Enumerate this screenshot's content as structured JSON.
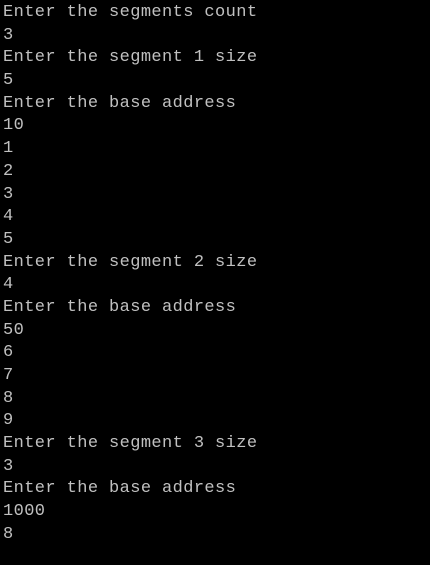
{
  "console": {
    "text_color": "#c0c0c0",
    "background_color": "#000000",
    "lines": [
      "Enter the segments count",
      "3",
      "Enter the segment 1 size",
      "5",
      "Enter the base address",
      "10",
      "1",
      "2",
      "3",
      "4",
      "5",
      "Enter the segment 2 size",
      "4",
      "Enter the base address",
      "50",
      "6",
      "7",
      "8",
      "9",
      "Enter the segment 3 size",
      "3",
      "Enter the base address",
      "1000",
      "8"
    ]
  }
}
